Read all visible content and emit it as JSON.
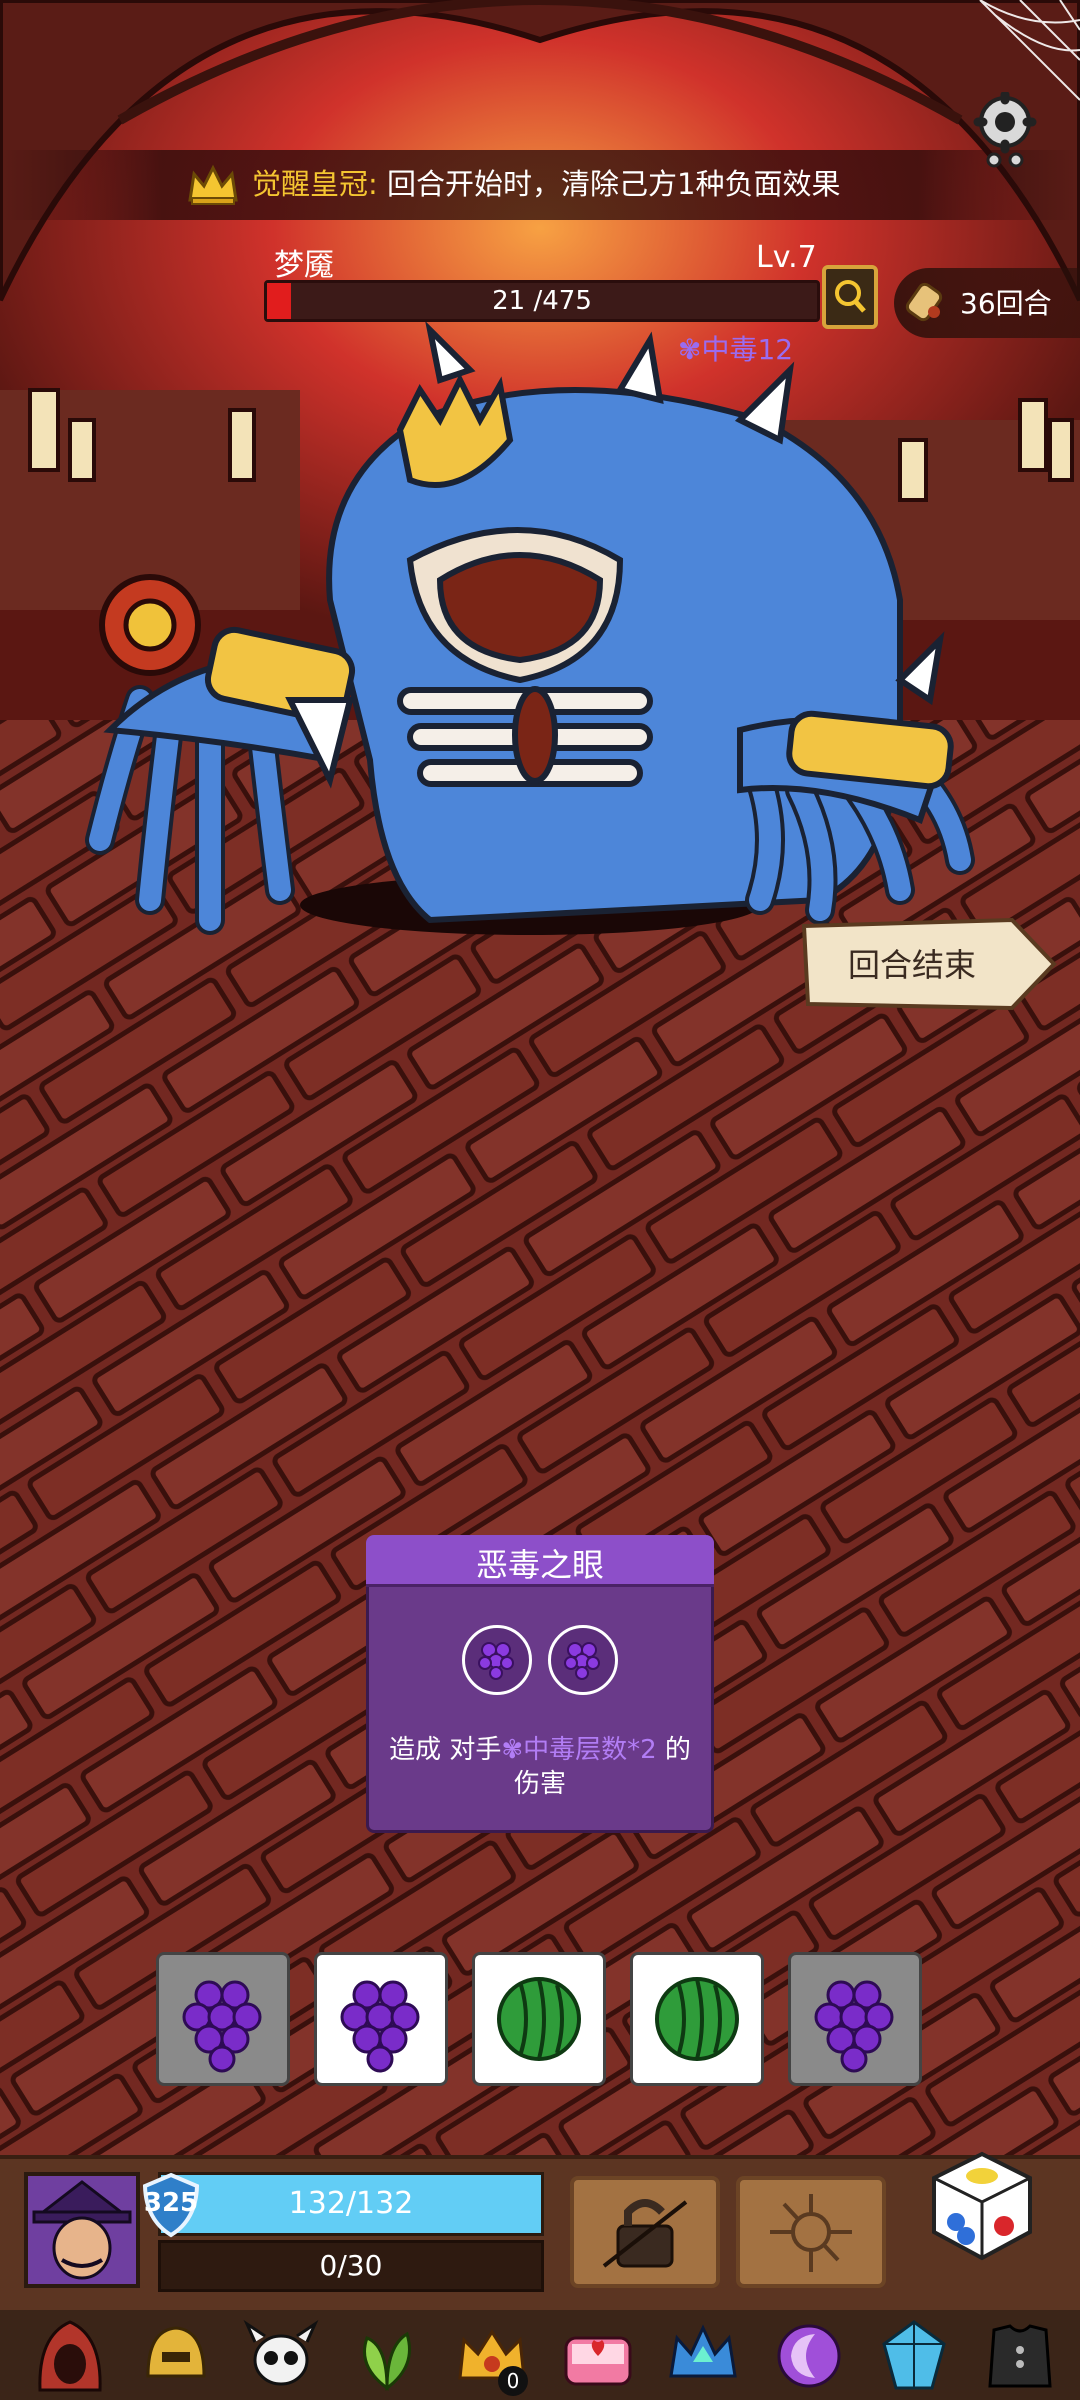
{
  "banner": {
    "relic_name": "觉醒皇冠:",
    "effect": "回合开始时，清除己方1种负面效果"
  },
  "boss": {
    "name": "梦魇",
    "level": "Lv.7",
    "hp_text": "21 /475",
    "hp_fraction": 0.044,
    "status_text": "中毒12"
  },
  "turn": {
    "rounds_text": "36回合",
    "end_turn_label": "回合结束"
  },
  "card": {
    "title": "恶毒之眼",
    "desc_prefix": "造成 对手",
    "desc_poison": "中毒层数*2",
    "desc_suffix": " 的",
    "desc_line2": "伤害",
    "slots": [
      "grape",
      "grape"
    ]
  },
  "dice": [
    {
      "face": "grape",
      "state": "used"
    },
    {
      "face": "grape",
      "state": "open"
    },
    {
      "face": "watermelon",
      "state": "open"
    },
    {
      "face": "watermelon",
      "state": "open"
    },
    {
      "face": "grape",
      "state": "used"
    }
  ],
  "player": {
    "shield": "325",
    "hp_text": "132/132",
    "exp_text": "0/30"
  },
  "relics": {
    "badge_count": "0",
    "icons": [
      "red-hood-icon",
      "gold-helmet-icon",
      "skull-horn-icon",
      "leaf-icon",
      "gold-crown-icon",
      "lunchbox-icon",
      "crystal-crown-icon",
      "moon-icon",
      "blue-gem-icon",
      "armor-icon"
    ]
  },
  "colors": {
    "grape": "#7a2cc9",
    "watermelon": "#2f9c3a",
    "poison": "#9a6cf0",
    "hp_bar": "#e11d1d",
    "player_hp": "#62cdf5",
    "gold": "#f4c531"
  }
}
